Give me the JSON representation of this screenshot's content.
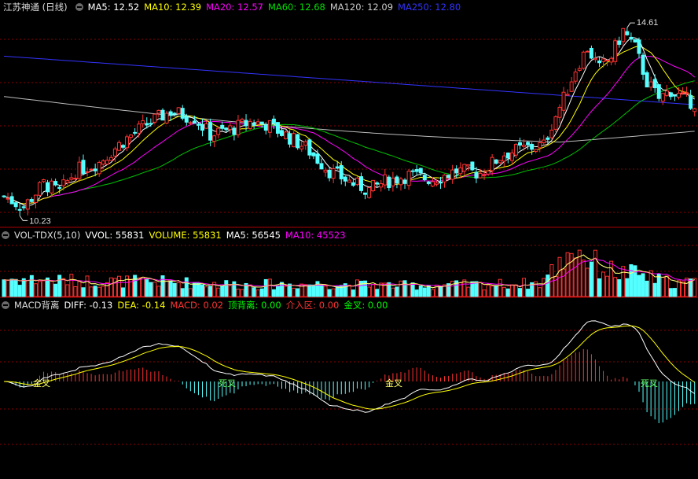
{
  "price_header": {
    "stock": "江苏神通 (日线)",
    "items": [
      {
        "label": "MA5: 12.52",
        "color": "#ffffff"
      },
      {
        "label": "MA10: 12.39",
        "color": "#ffff00"
      },
      {
        "label": "MA20: 12.57",
        "color": "#ff00ff"
      },
      {
        "label": "MA60: 12.68",
        "color": "#00e000"
      },
      {
        "label": "MA120: 12.09",
        "color": "#cccccc"
      },
      {
        "label": "MA250: 12.80",
        "color": "#3333ff"
      }
    ]
  },
  "vol_header": {
    "name": "VOL-TDX(5,10)",
    "items": [
      {
        "label": "VVOL: 55831",
        "color": "#ffffff"
      },
      {
        "label": "VOLUME: 55831",
        "color": "#ffff00"
      },
      {
        "label": "MA5: 56545",
        "color": "#ffffff"
      },
      {
        "label": "MA10: 45523",
        "color": "#ff00ff"
      }
    ]
  },
  "macd_header": {
    "name": "MACD背离",
    "items": [
      {
        "label": "DIFF: -0.13",
        "color": "#ffffff"
      },
      {
        "label": "DEA: -0.14",
        "color": "#ffff00"
      },
      {
        "label": "MACD: 0.02",
        "color": "#ff3333"
      },
      {
        "label": "顶背离: 0.00",
        "color": "#00ff00"
      },
      {
        "label": "介入区: 0.00",
        "color": "#ff3333"
      },
      {
        "label": "金叉: 0.00",
        "color": "#00ff00"
      }
    ]
  },
  "annotations": {
    "high_label": "14.61",
    "low_label": "10.23",
    "golden_cross": "金叉",
    "death_cross": "死叉"
  },
  "colors": {
    "up": "#ff3232",
    "down": "#54ffff",
    "grid": "#8b0000"
  },
  "chart_data": {
    "type": "candlestick",
    "price_range": [
      10.0,
      15.0
    ],
    "high": 14.61,
    "low": 10.23,
    "price_anchors": [
      [
        0,
        10.6
      ],
      [
        5,
        10.35
      ],
      [
        10,
        10.9
      ],
      [
        14,
        10.7
      ],
      [
        18,
        11.2
      ],
      [
        24,
        11.4
      ],
      [
        30,
        11.9
      ],
      [
        36,
        12.3
      ],
      [
        42,
        12.6
      ],
      [
        48,
        12.45
      ],
      [
        52,
        12.05
      ],
      [
        58,
        12.2
      ],
      [
        62,
        12.35
      ],
      [
        66,
        12.3
      ],
      [
        70,
        12.1
      ],
      [
        76,
        11.75
      ],
      [
        82,
        11.2
      ],
      [
        88,
        10.9
      ],
      [
        92,
        10.75
      ],
      [
        96,
        10.95
      ],
      [
        102,
        11.1
      ],
      [
        108,
        11.0
      ],
      [
        114,
        11.2
      ],
      [
        120,
        11.15
      ],
      [
        126,
        11.6
      ],
      [
        132,
        11.75
      ],
      [
        136,
        11.8
      ],
      [
        138,
        12.3
      ],
      [
        141,
        12.9
      ],
      [
        144,
        13.6
      ],
      [
        147,
        14.1
      ],
      [
        150,
        13.6
      ],
      [
        153,
        13.9
      ],
      [
        156,
        14.5
      ],
      [
        159,
        14.1
      ],
      [
        162,
        13.3
      ],
      [
        165,
        12.9
      ],
      [
        168,
        13.1
      ],
      [
        171,
        12.9
      ],
      [
        174,
        12.8
      ]
    ],
    "volume_anchors": [
      [
        0,
        1.2
      ],
      [
        20,
        1.05
      ],
      [
        40,
        1.0
      ],
      [
        60,
        0.8
      ],
      [
        80,
        0.85
      ],
      [
        100,
        0.75
      ],
      [
        120,
        0.8
      ],
      [
        135,
        0.9
      ],
      [
        140,
        2.2
      ],
      [
        143,
        3.5
      ],
      [
        146,
        2.8
      ],
      [
        150,
        2.0
      ],
      [
        155,
        1.6
      ],
      [
        160,
        1.5
      ],
      [
        165,
        1.1
      ],
      [
        170,
        0.9
      ],
      [
        174,
        1.0
      ]
    ],
    "macd_header_values": {
      "DIFF": -0.13,
      "DEA": -0.14,
      "MACD": 0.02
    }
  }
}
